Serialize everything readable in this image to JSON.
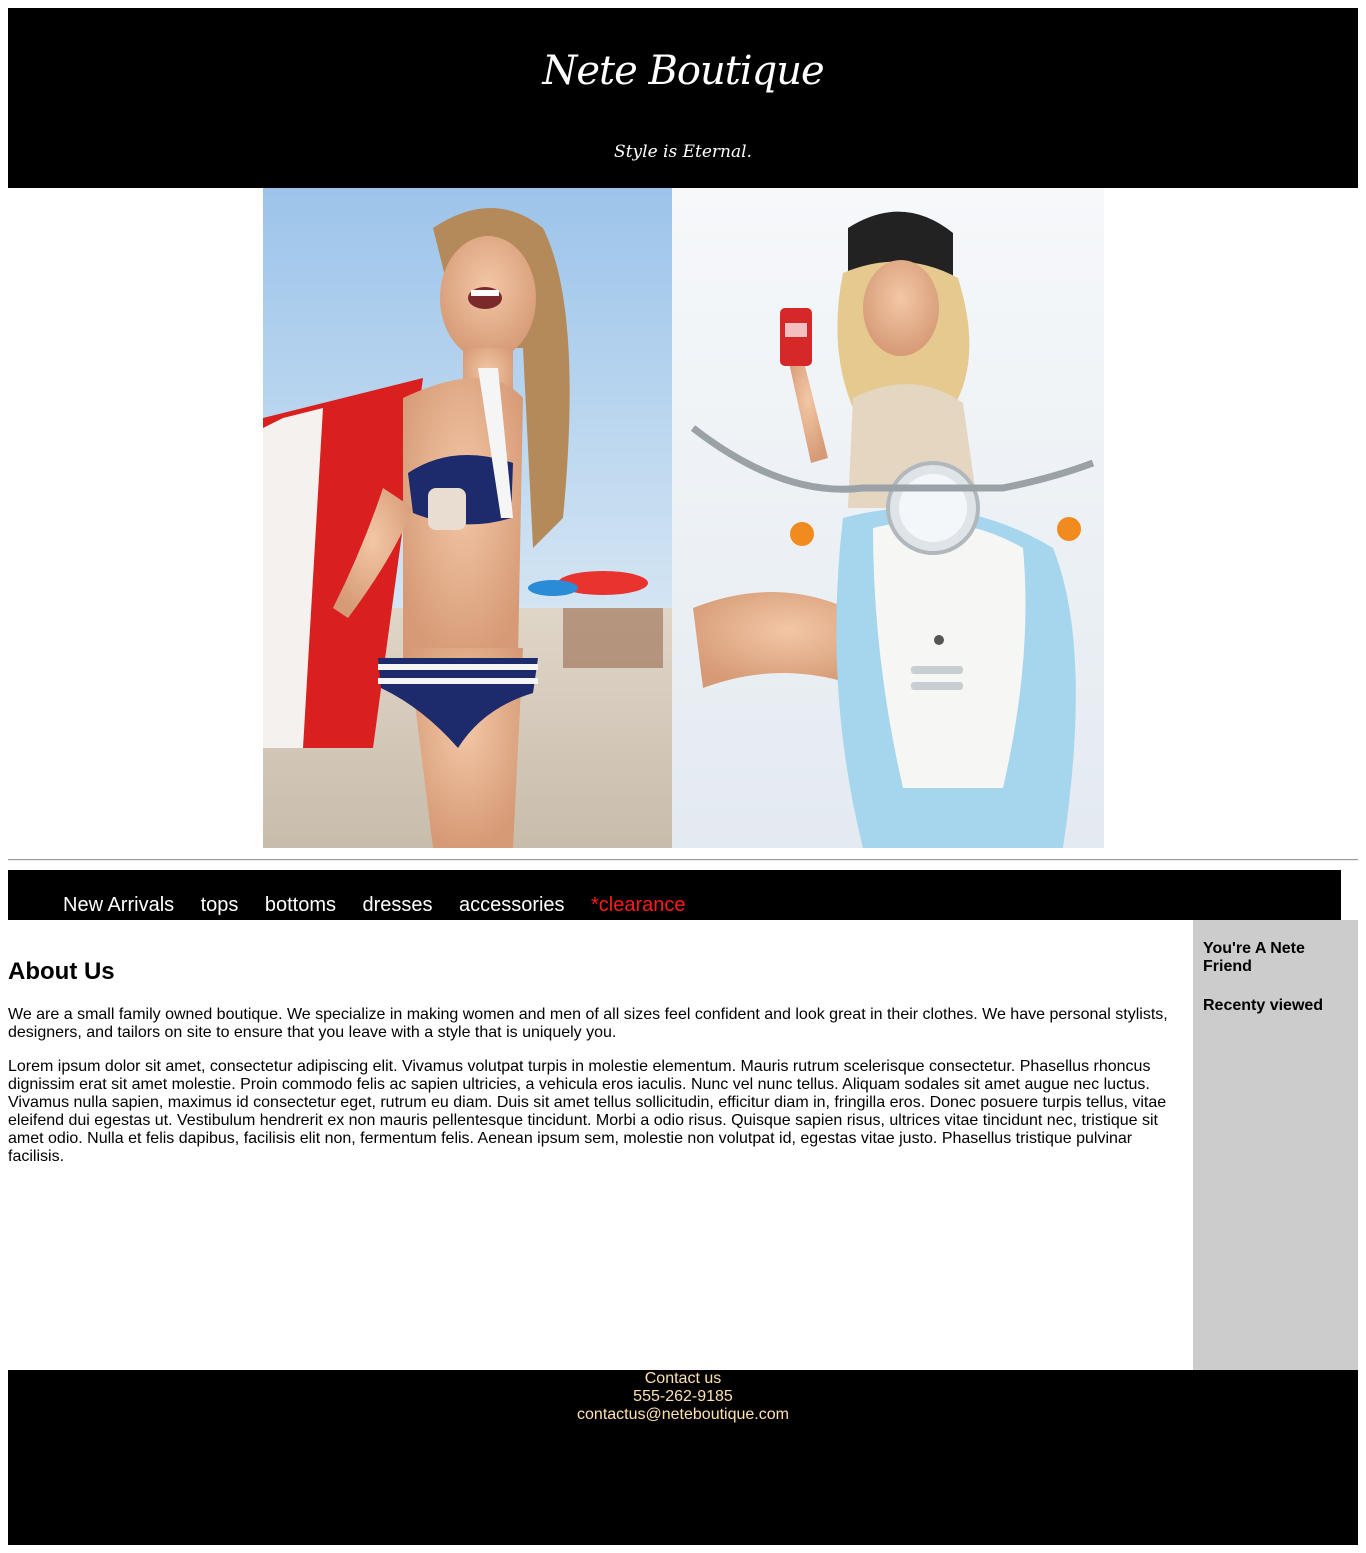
{
  "header": {
    "title": "Nete Boutique",
    "tagline": "Style is Eternal."
  },
  "nav": {
    "items": [
      {
        "label": "New Arrivals"
      },
      {
        "label": "tops"
      },
      {
        "label": "bottoms"
      },
      {
        "label": "dresses"
      },
      {
        "label": "accessories"
      },
      {
        "label": "*clearance"
      }
    ]
  },
  "main": {
    "heading": "About Us",
    "paragraph1": "We are a small family owned boutique. We specialize in making women and men of all sizes feel confident and look great in their clothes. We have personal stylists, designers, and tailors on site to ensure that you leave with a style that is uniquely you.",
    "paragraph2": "Lorem ipsum dolor sit amet, consectetur adipiscing elit. Vivamus volutpat turpis in molestie elementum. Mauris rutrum scelerisque consectetur. Phasellus rhoncus dignissim erat sit amet molestie. Proin commodo felis ac sapien ultricies, a vehicula eros iaculis. Nunc vel nunc tellus. Aliquam sodales sit amet augue nec luctus. Vivamus nulla sapien, maximus id consectetur eget, rutrum eu diam. Duis sit amet tellus sollicitudin, efficitur diam in, fringilla eros. Donec posuere turpis tellus, vitae eleifend dui egestas ut. Vestibulum hendrerit ex non mauris pellentesque tincidunt. Morbi a odio risus. Quisque sapien risus, ultrices vitae tincidunt nec, tristique sit amet odio. Nulla et felis dapibus, facilisis elit non, fermentum felis. Aenean ipsum sem, molestie non volutpat id, egestas vitae justo. Phasellus tristique pulvinar facilisis."
  },
  "sidebar": {
    "friend_heading": "You're A Nete Friend",
    "recent_heading": "Recenty viewed"
  },
  "footer": {
    "contact_label": "Contact us",
    "phone": "555-262-9185",
    "email": "contactus@neteboutique.com"
  },
  "colors": {
    "header_bg": "#000000",
    "nav_clearance": "#ff1a1a",
    "sidebar_bg": "#cccccc",
    "footer_text": "#ffe0b0"
  }
}
